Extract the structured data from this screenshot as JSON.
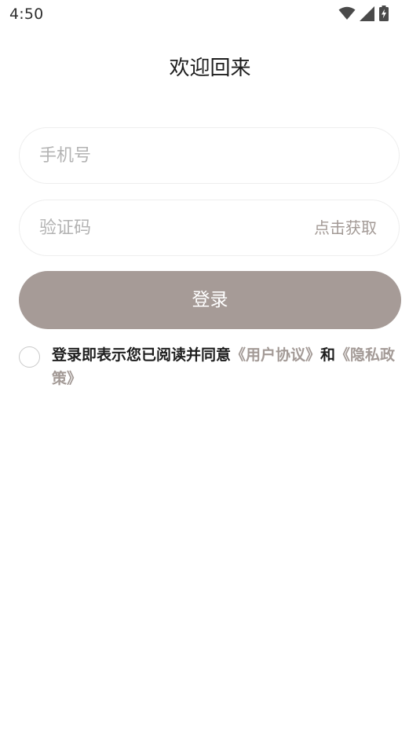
{
  "status_bar": {
    "time": "4:50",
    "icons": [
      "wifi-icon",
      "cell-signal-icon",
      "battery-charging-icon"
    ]
  },
  "page": {
    "title": "欢迎回来"
  },
  "form": {
    "phone_placeholder": "手机号",
    "code_placeholder": "验证码",
    "get_code_label": "点击获取",
    "login_label": "登录"
  },
  "agreement": {
    "prefix": "登录即表示您已阅读并同意",
    "user_agreement": "《用户协议》",
    "connector": "和",
    "privacy_policy": "《隐私政策》",
    "checked": false
  },
  "colors": {
    "accent": "#a69b97",
    "link": "#a39a96",
    "placeholder": "#b3b3b3",
    "field_border": "#eeeeee"
  }
}
